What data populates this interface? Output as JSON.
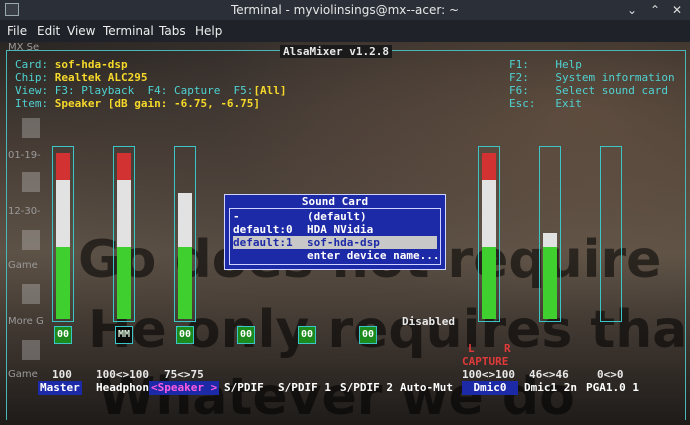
{
  "window": {
    "title": "Terminal - myviolinsings@mx--acer: ~"
  },
  "menu": [
    "File",
    "Edit",
    "View",
    "Terminal",
    "Tabs",
    "Help"
  ],
  "app": {
    "title": "AlsaMixer v1.2.8"
  },
  "info": {
    "card_label": "Card:",
    "card": "sof-hda-dsp",
    "chip_label": "Chip:",
    "chip": "Realtek ALC295",
    "view_label": "View:",
    "view_opts": "F3: Playback  F4: Capture  F5:",
    "view_active": "[All]",
    "item_label": "Item:",
    "item": "Speaker [dB gain: -6.75, -6.75]"
  },
  "help": [
    {
      "key": "F1:",
      "label": "Help"
    },
    {
      "key": "F2:",
      "label": "System information"
    },
    {
      "key": "F6:",
      "label": "Select sound card"
    },
    {
      "key": "Esc:",
      "label": "Exit"
    }
  ],
  "channels": [
    {
      "name": "Master",
      "value": "100",
      "mute": "00",
      "level": 1.0
    },
    {
      "name": "Headphon",
      "value": "100<>100",
      "mute": "MM",
      "level": 1.0
    },
    {
      "name": "<Speaker >",
      "value": "75<>75",
      "mute": "00",
      "level": 0.75
    },
    {
      "name": "S/PDIF",
      "value": "",
      "mute": "00"
    },
    {
      "name": "S/PDIF 1",
      "value": "",
      "mute": "00"
    },
    {
      "name": "S/PDIF 2",
      "value": "",
      "mute": "00"
    },
    {
      "name": "Auto-Mut",
      "value": "Disabled"
    },
    {
      "name": "Dmic0",
      "value": "100<>100",
      "level": 1.0
    },
    {
      "name": "Dmic1 2n",
      "value": "46<>46",
      "level": 0.46
    },
    {
      "name": "PGA1.0 1",
      "value": "0<>0",
      "level": 0.0
    }
  ],
  "capture": {
    "l": "L",
    "r": "R",
    "label": "CAPTURE"
  },
  "dialog": {
    "title": "Sound Card",
    "items": [
      {
        "key": "-",
        "value": "(default)"
      },
      {
        "key": "default:0",
        "value": "HDA NVidia"
      },
      {
        "key": "default:1",
        "value": "sof-hda-dsp"
      },
      {
        "key": "",
        "value": "enter device name..."
      }
    ]
  },
  "desktop": {
    "labels": [
      "MX Se",
      "01-19-",
      "12-30-",
      "Game",
      "More G",
      "Game"
    ]
  },
  "wallpaper_text": [
    "Go  does not require",
    "He only requires tha",
    "Whatever we do"
  ]
}
